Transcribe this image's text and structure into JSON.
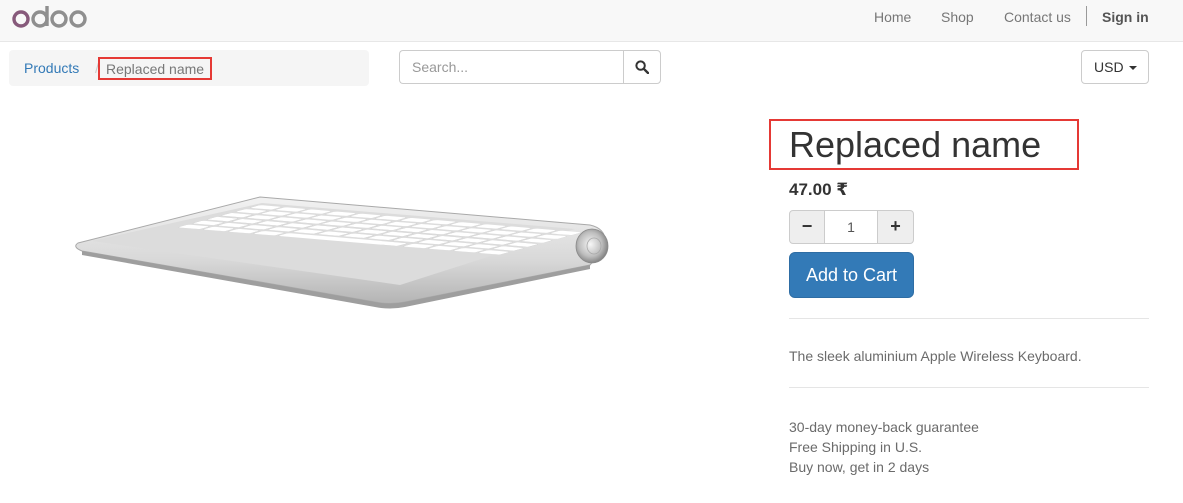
{
  "brand": {
    "logo_text": "odoo",
    "logo_colors": [
      "#875a7b",
      "#8f8f8f"
    ]
  },
  "nav": {
    "links": [
      {
        "label": "Home"
      },
      {
        "label": "Shop"
      },
      {
        "label": "Contact us"
      }
    ],
    "signin_label": "Sign in"
  },
  "breadcrumb": {
    "root": "Products",
    "separator": "/",
    "current": "Replaced name"
  },
  "search": {
    "placeholder": "Search...",
    "value": "",
    "icon": "search-icon"
  },
  "currency": {
    "selected": "USD",
    "icon": "caret-down-icon"
  },
  "product": {
    "title": "Replaced name",
    "price": "47.00 ₹",
    "quantity": "1",
    "minus_label": "−",
    "plus_label": "+",
    "add_to_cart_label": "Add to Cart",
    "description": "The sleek aluminium Apple Wireless Keyboard.",
    "benefits": [
      "30-day money-back guarantee",
      "Free Shipping in U.S.",
      "Buy now, get in 2 days"
    ],
    "image": "keyboard-image"
  },
  "colors": {
    "accent": "#337ab7",
    "highlight_box": "#e53935",
    "navbar_bg": "#f8f8f8"
  }
}
